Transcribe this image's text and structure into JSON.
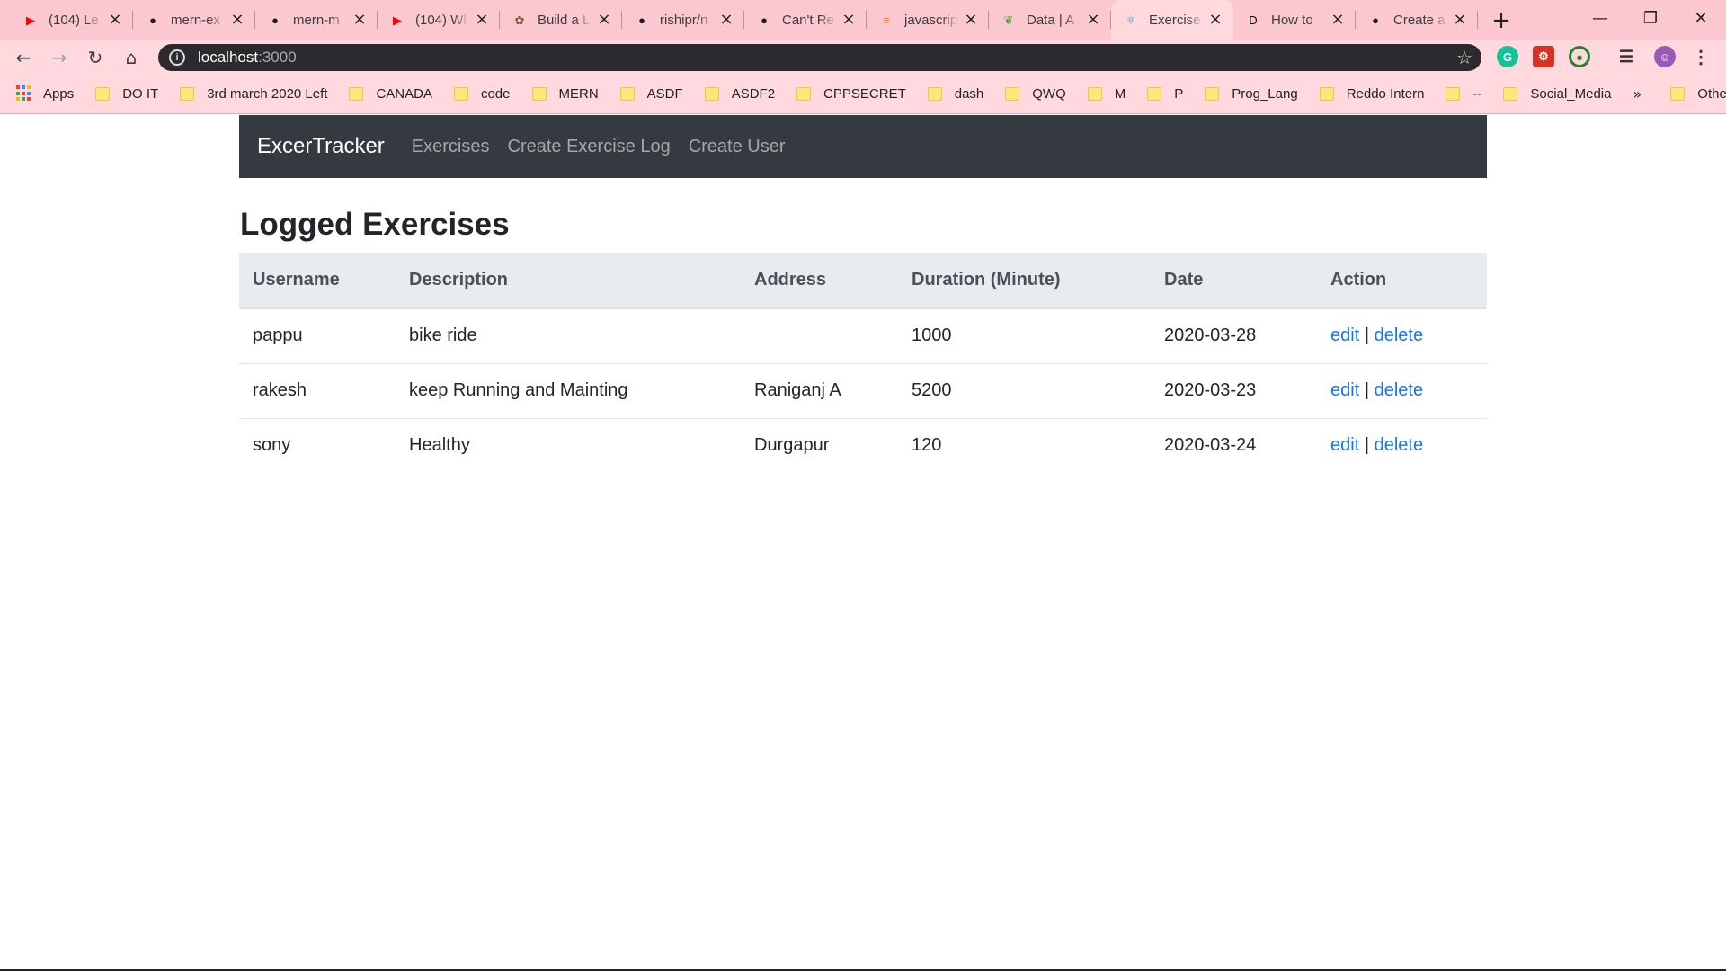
{
  "browser": {
    "tabs": [
      {
        "title": "(104) Le",
        "icon": "youtube-icon",
        "color": "#ff0000"
      },
      {
        "title": "mern-ex",
        "icon": "github-icon",
        "color": "#1b1f23"
      },
      {
        "title": "mern-m",
        "icon": "github-icon",
        "color": "#1b1f23"
      },
      {
        "title": "(104) Wl",
        "icon": "youtube-icon",
        "color": "#ff0000"
      },
      {
        "title": "Build a L",
        "icon": "pug-icon",
        "color": "#7a5c3a"
      },
      {
        "title": "rishipr/n",
        "icon": "github-icon",
        "color": "#1b1f23"
      },
      {
        "title": "Can't Re",
        "icon": "github-icon",
        "color": "#1b1f23"
      },
      {
        "title": "javascrip",
        "icon": "stackoverflow-icon",
        "color": "#f48024"
      },
      {
        "title": "Data | A",
        "icon": "mongodb-leaf-icon",
        "color": "#4db33d"
      },
      {
        "title": "Exercise",
        "icon": "react-icon",
        "color": "#2aa6c8",
        "active": true
      },
      {
        "title": "How to",
        "icon": "dev-icon",
        "color": "#0a0a0a"
      },
      {
        "title": "Create a",
        "icon": "github-icon",
        "color": "#1b1f23"
      }
    ],
    "url": {
      "host": "localhost",
      "port": ":3000"
    },
    "bookmarks": [
      "DO IT",
      "3rd march 2020 Left",
      "CANADA",
      "code",
      "MERN",
      "ASDF",
      "ASDF2",
      "CPPSECRET",
      "dash",
      "QWQ",
      "M",
      "P",
      "Prog_Lang",
      "Reddo Intern",
      "--",
      "Social_Media"
    ],
    "apps_label": "Apps",
    "more_bookmarks": "»",
    "other_bookmarks": "Other bookmarks"
  },
  "app": {
    "brand": "ExcerTracker",
    "nav": [
      "Exercises",
      "Create Exercise Log",
      "Create User"
    ],
    "heading": "Logged Exercises",
    "columns": [
      "Username",
      "Description",
      "Address",
      "Duration (Minute)",
      "Date",
      "Action"
    ],
    "rows": [
      {
        "username": "pappu",
        "description": "bike ride",
        "address": "",
        "duration": "1000",
        "date": "2020-03-28"
      },
      {
        "username": "rakesh",
        "description": "keep Running and Mainting",
        "address": "Raniganj A",
        "duration": "5200",
        "date": "2020-03-23"
      },
      {
        "username": "sony",
        "description": "Healthy",
        "address": "Durgapur",
        "duration": "120",
        "date": "2020-03-24"
      }
    ],
    "action_edit": "edit",
    "action_sep": "|",
    "action_delete": "delete",
    "colors": {
      "navbar": "#343a40",
      "link": "#1a73e8",
      "header_bg": "#e9ecef"
    }
  }
}
